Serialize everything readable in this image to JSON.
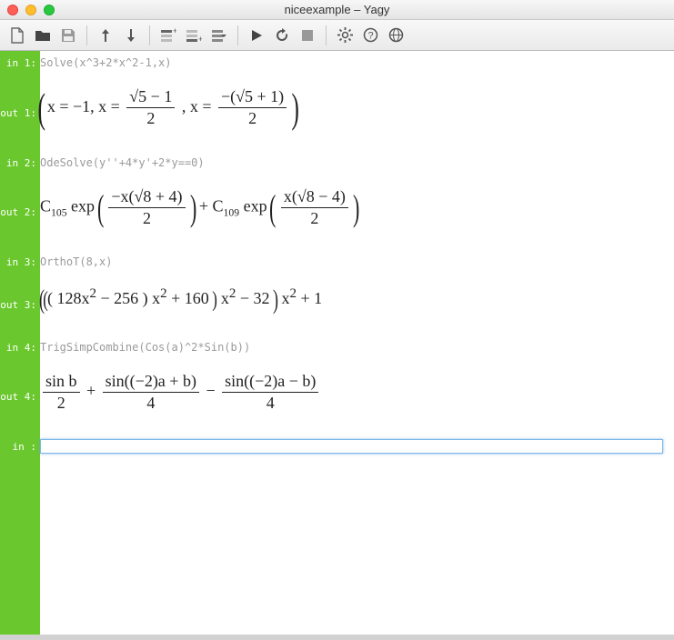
{
  "window": {
    "title": "niceexample – Yagy"
  },
  "toolbar": {
    "icons": [
      "new",
      "open",
      "save",
      "up",
      "down",
      "indent",
      "unindent",
      "menu",
      "run",
      "reload",
      "stop",
      "settings",
      "help",
      "globe"
    ]
  },
  "cells": {
    "in1": {
      "label": "in  1:",
      "code": "Solve(x^3+2*x^2-1,x)"
    },
    "out1": {
      "label": "out 1:",
      "parts": {
        "pre": "x = ",
        "v1": "−1",
        "comma1": ", x = ",
        "f2num": "√5 − 1",
        "f2den": "2",
        "comma2": " , x = ",
        "f3num": "−(√5 + 1)",
        "f3den": "2"
      }
    },
    "in2": {
      "label": "in  2:",
      "code": "OdeSolve(y''+4*y'+2*y==0)"
    },
    "out2": {
      "label": "out 2:",
      "parts": {
        "c1": "C",
        "s1": "105",
        "exp1": " exp",
        "f1num": "−x(√8 + 4)",
        "f1den": "2",
        "plus": " + ",
        "c2": "C",
        "s2": "109",
        "exp2": " exp",
        "f2num": "x(√8 − 4)",
        "f2den": "2"
      }
    },
    "in3": {
      "label": "in  3:",
      "code": "OrthoT(8,x)"
    },
    "out3": {
      "label": "out 3:",
      "parts": {
        "t1": "128x",
        "t1e": "2",
        "t2": " − 256",
        "t3": "x",
        "t3e": "2",
        "t4": " + 160",
        "t5": "x",
        "t5e": "2",
        "t6": " − 32",
        "t7": "x",
        "t7e": "2",
        "t8": " + 1"
      }
    },
    "in4": {
      "label": "in  4:",
      "code": "TrigSimpCombine(Cos(a)^2*Sin(b))"
    },
    "out4": {
      "label": "out 4:",
      "parts": {
        "f1num": "sin b",
        "f1den": "2",
        "op1": " + ",
        "f2num": "sin((−2)a + b)",
        "f2den": "4",
        "op2": " − ",
        "f3num": "sin((−2)a − b)",
        "f3den": "4"
      }
    },
    "inNew": {
      "label": "in   :",
      "value": ""
    }
  }
}
